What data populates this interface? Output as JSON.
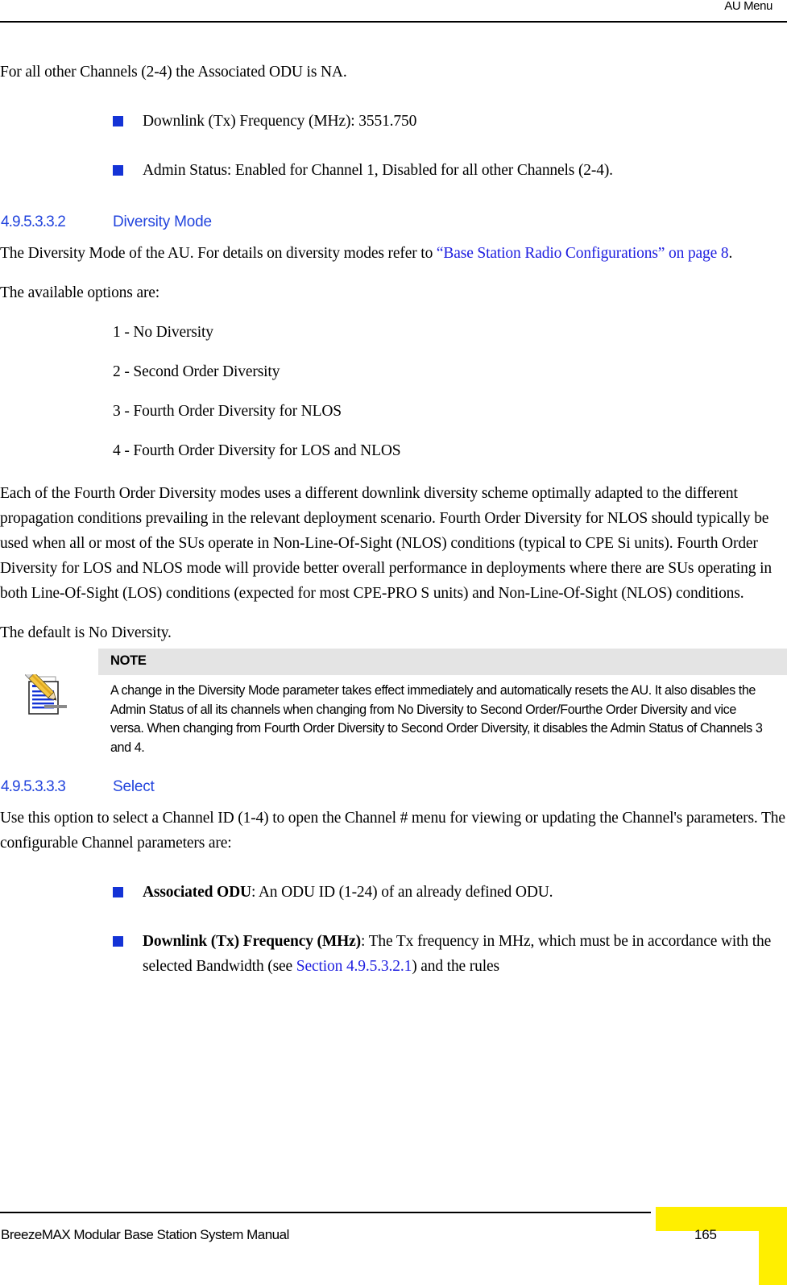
{
  "header": {
    "running_head": "AU Menu"
  },
  "body": {
    "intro_note": "For all other Channels (2-4) the Associated ODU is NA.",
    "bullets_top": [
      "Downlink (Tx) Frequency (MHz): 3551.750",
      "Admin Status: Enabled for Channel 1, Disabled for all other Channels (2-4)."
    ]
  },
  "section_diversity": {
    "number": "4.9.5.3.3.2",
    "title": "Diversity Mode",
    "intro_before_link": "The Diversity Mode of the AU. For details on diversity modes refer to ",
    "link_text": "“Base Station Radio Configurations” on page 8",
    "intro_after_link": ".",
    "options_lead": "The available options are:",
    "options": [
      "1 - No Diversity",
      "2 - Second Order Diversity",
      "3 - Fourth Order Diversity for NLOS",
      "4 - Fourth Order Diversity for LOS and NLOS"
    ],
    "explanation": "Each of the Fourth Order Diversity modes uses a different downlink diversity scheme optimally adapted to the different propagation conditions prevailing in the relevant deployment scenario. Fourth Order Diversity for NLOS should typically be used when all or most of the SUs operate in Non-Line-Of-Sight (NLOS) conditions (typical to CPE Si units). Fourth Order Diversity for LOS and NLOS mode will provide better overall performance in deployments where there are SUs operating in both Line-Of-Sight (LOS) conditions (expected for most CPE-PRO S units) and Non-Line-Of-Sight (NLOS) conditions.",
    "default_text": "The default is No Diversity."
  },
  "note": {
    "label": "NOTE",
    "icon": "notepad-pencil-icon",
    "text": "A change in the Diversity Mode parameter takes effect immediately and automatically resets the AU. It also disables the Admin Status of all its channels when changing from No Diversity to Second Order/Fourthe Order Diversity and vice versa. When changing from Fourth Order Diversity to Second Order Diversity, it disables the Admin Status of Channels 3 and 4."
  },
  "section_select": {
    "number": "4.9.5.3.3.3",
    "title": "Select",
    "intro": "Use this option to select a Channel ID (1-4) to open the Channel # menu for viewing or updating the Channel's parameters. The configurable Channel parameters are:",
    "bullets": [
      {
        "bold": "Associated ODU",
        "rest": ": An ODU ID (1-24) of an already defined ODU."
      },
      {
        "bold": "Downlink (Tx) Frequency (MHz)",
        "rest_before_link": ": The Tx frequency in MHz, which must be in accordance with the selected Bandwidth (see ",
        "link_text": "Section 4.9.5.3.2.1",
        "rest_after_link": ") and the rules"
      }
    ]
  },
  "footer": {
    "manual_title": "BreezeMAX Modular Base Station System Manual",
    "page_number": "165"
  },
  "colors": {
    "heading_blue": "#2244dd",
    "link_blue": "#2020e0",
    "bullet_blue": "#1433d6",
    "note_bar_gray": "#e4e4e4",
    "footer_yellow": "#ffef00"
  }
}
